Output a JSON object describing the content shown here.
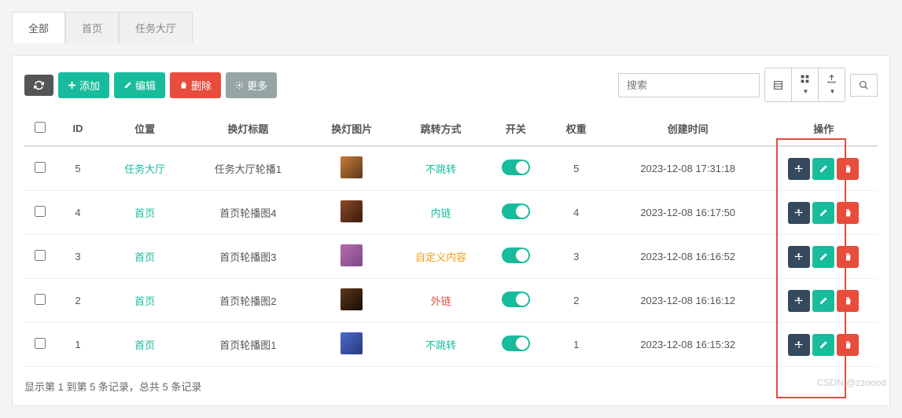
{
  "tabs": [
    {
      "label": "全部",
      "active": true
    },
    {
      "label": "首页",
      "active": false
    },
    {
      "label": "任务大厅",
      "active": false
    }
  ],
  "toolbar": {
    "add_label": "添加",
    "edit_label": "编辑",
    "delete_label": "删除",
    "more_label": "更多",
    "search_placeholder": "搜索"
  },
  "columns": {
    "checkbox": "",
    "id": "ID",
    "position": "位置",
    "title": "换灯标题",
    "image": "换灯图片",
    "jump_type": "跳转方式",
    "switch": "开关",
    "weight": "权重",
    "created_at": "创建时间",
    "actions": "操作"
  },
  "rows": [
    {
      "id": "5",
      "position": "任务大厅",
      "pos_class": "alt",
      "title": "任务大厅轮播1",
      "thumb_color": "linear-gradient(135deg,#c97b3a,#5a3a1a)",
      "jump": "不跳转",
      "jump_class": "jump-none",
      "switch": true,
      "weight": "5",
      "created_at": "2023-12-08 17:31:18"
    },
    {
      "id": "4",
      "position": "首页",
      "pos_class": "",
      "title": "首页轮播图4",
      "thumb_color": "linear-gradient(135deg,#8a4a2a,#3a1a0a)",
      "jump": "内链",
      "jump_class": "jump-inner",
      "switch": true,
      "weight": "4",
      "created_at": "2023-12-08 16:17:50"
    },
    {
      "id": "3",
      "position": "首页",
      "pos_class": "",
      "title": "首页轮播图3",
      "thumb_color": "linear-gradient(135deg,#b86aaa,#7a4a8a)",
      "jump": "自定义内容",
      "jump_class": "jump-custom",
      "switch": true,
      "weight": "3",
      "created_at": "2023-12-08 16:16:52"
    },
    {
      "id": "2",
      "position": "首页",
      "pos_class": "",
      "title": "首页轮播图2",
      "thumb_color": "linear-gradient(135deg,#5a3a1a,#1a0a05)",
      "jump": "外链",
      "jump_class": "jump-outer",
      "switch": true,
      "weight": "2",
      "created_at": "2023-12-08 16:16:12"
    },
    {
      "id": "1",
      "position": "首页",
      "pos_class": "",
      "title": "首页轮播图1",
      "thumb_color": "linear-gradient(135deg,#4a6aca,#2a3a7a)",
      "jump": "不跳转",
      "jump_class": "jump-none",
      "switch": true,
      "weight": "1",
      "created_at": "2023-12-08 16:15:32"
    }
  ],
  "footer_text": "显示第 1 到第 5 条记录，总共 5 条记录",
  "watermark": "CSDN @zzoood"
}
